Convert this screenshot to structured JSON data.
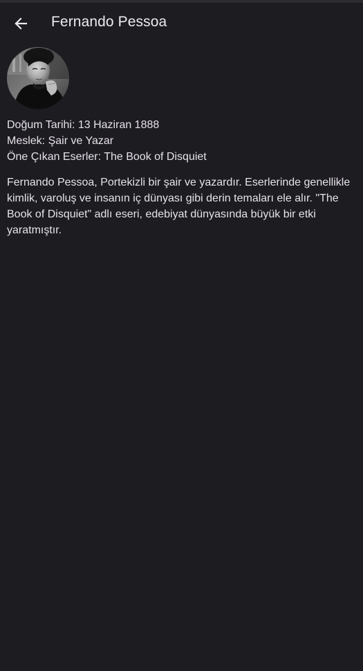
{
  "app_bar": {
    "title": "Fernando Pessoa",
    "back_icon": "arrow-back-icon"
  },
  "profile": {
    "avatar_icon": "author-portrait",
    "details": [
      {
        "text": "Doğum Tarihi: 13 Haziran 1888"
      },
      {
        "text": "Meslek: Şair ve Yazar"
      },
      {
        "text": "Öne Çıkan Eserler: The Book of Disquiet"
      }
    ],
    "bio": "Fernando Pessoa, Portekizli bir şair ve yazardır. Eserlerinde genellikle kimlik, varoluş ve insanın iç dünyası gibi derin temaları ele alır. \"The Book of Disquiet\" adlı eseri, edebiyat dünyasında büyük bir etki yaratmıştır."
  },
  "colors": {
    "background": "#1d1c21",
    "text": "#e6e3ea",
    "status_strip": "#2c2b2f"
  }
}
